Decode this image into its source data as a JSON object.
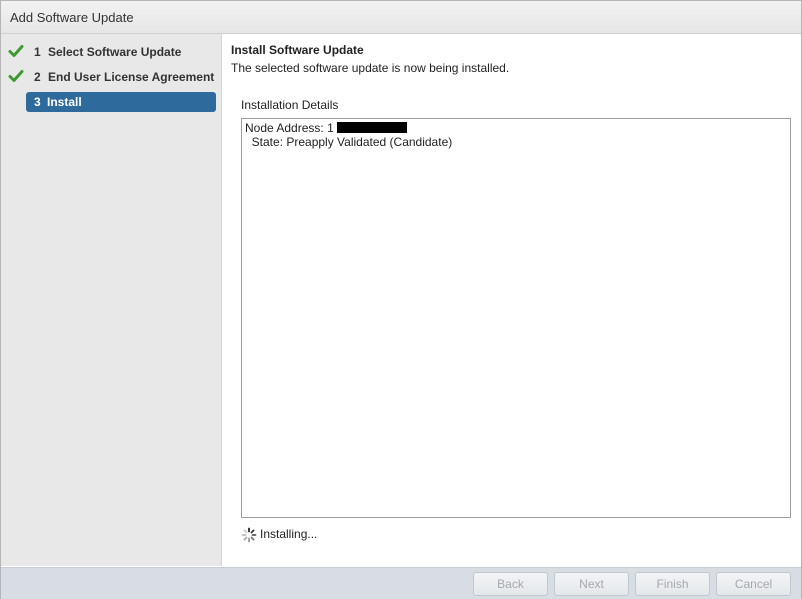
{
  "window": {
    "title": "Add Software Update"
  },
  "steps": [
    {
      "number": "1",
      "label": "Select Software Update",
      "state": "completed",
      "icon": "checkmark-icon"
    },
    {
      "number": "2",
      "label": "End User License Agreement",
      "state": "completed",
      "icon": "checkmark-icon"
    },
    {
      "number": "3",
      "label": "Install",
      "state": "active"
    }
  ],
  "main": {
    "heading": "Install Software Update",
    "subtitle": "The selected software update is now being installed.",
    "details_label": "Installation Details",
    "details": {
      "node_label": "Node Address:",
      "node_value_visible": "1",
      "state_line": "  State: Preapply Validated (Candidate)"
    },
    "status_text": "Installing...",
    "status_icon": "spinner-icon"
  },
  "buttons": {
    "back": "Back",
    "next": "Next",
    "finish": "Finish",
    "cancel": "Cancel"
  },
  "colors": {
    "active_step": "#2f6a9d",
    "check": "#3d9a2e",
    "sidebar_bg": "#e8e8e8",
    "footer_bg": "#d7dde3"
  }
}
